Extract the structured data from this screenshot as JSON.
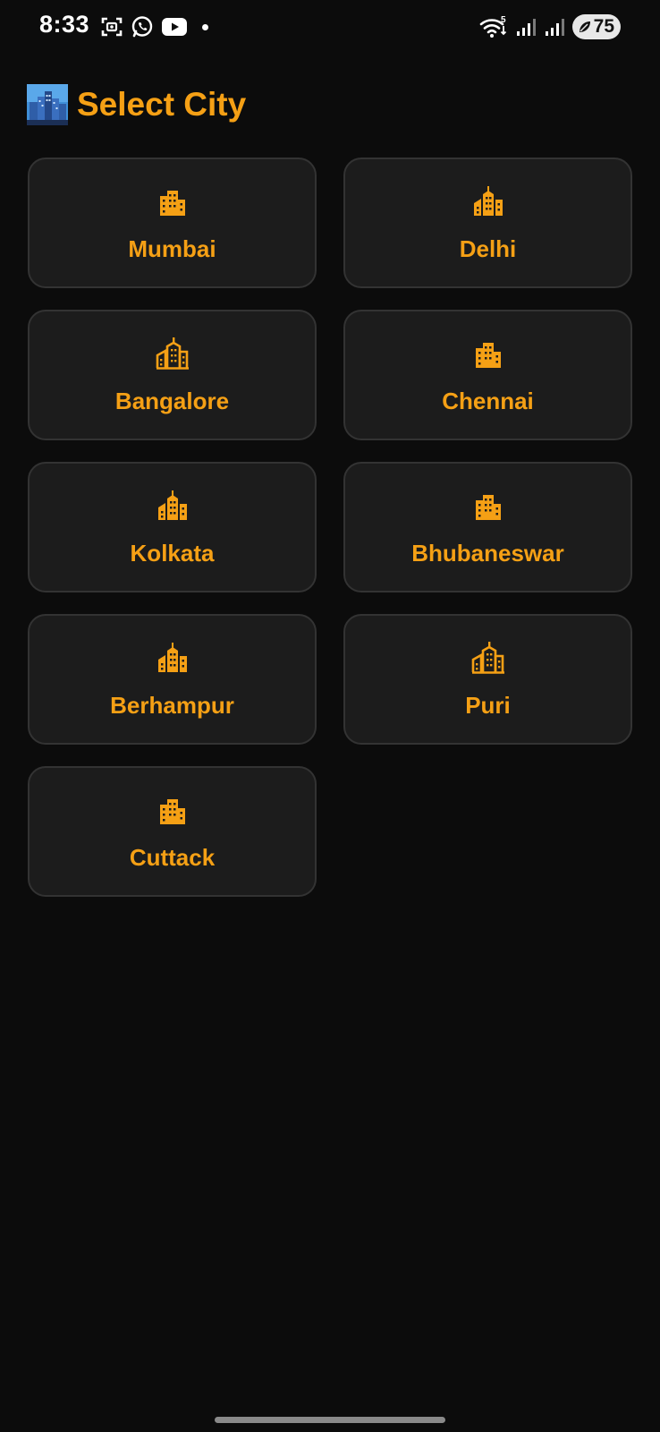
{
  "status_bar": {
    "time": "8:33",
    "left_icons": [
      "screenshot-icon",
      "whatsapp-icon",
      "youtube-icon",
      "notification-dot"
    ],
    "right_icons": [
      "wifi-icon",
      "signal-icon",
      "signal-icon"
    ],
    "wifi_badge": "5",
    "battery_level": "75"
  },
  "header": {
    "emoji_icon": "cityscape-icon",
    "title": "Select City"
  },
  "accent_color": "#f5a015",
  "cities": [
    {
      "name": "Mumbai",
      "icon": "city-buildings-icon"
    },
    {
      "name": "Delhi",
      "icon": "city-buildings-icon"
    },
    {
      "name": "Bangalore",
      "icon": "city-buildings-outline-icon"
    },
    {
      "name": "Chennai",
      "icon": "city-buildings-icon"
    },
    {
      "name": "Kolkata",
      "icon": "city-buildings-icon"
    },
    {
      "name": "Bhubaneswar",
      "icon": "city-buildings-icon"
    },
    {
      "name": "Berhampur",
      "icon": "city-buildings-icon"
    },
    {
      "name": "Puri",
      "icon": "city-buildings-outline-icon"
    },
    {
      "name": "Cuttack",
      "icon": "city-buildings-icon"
    }
  ]
}
